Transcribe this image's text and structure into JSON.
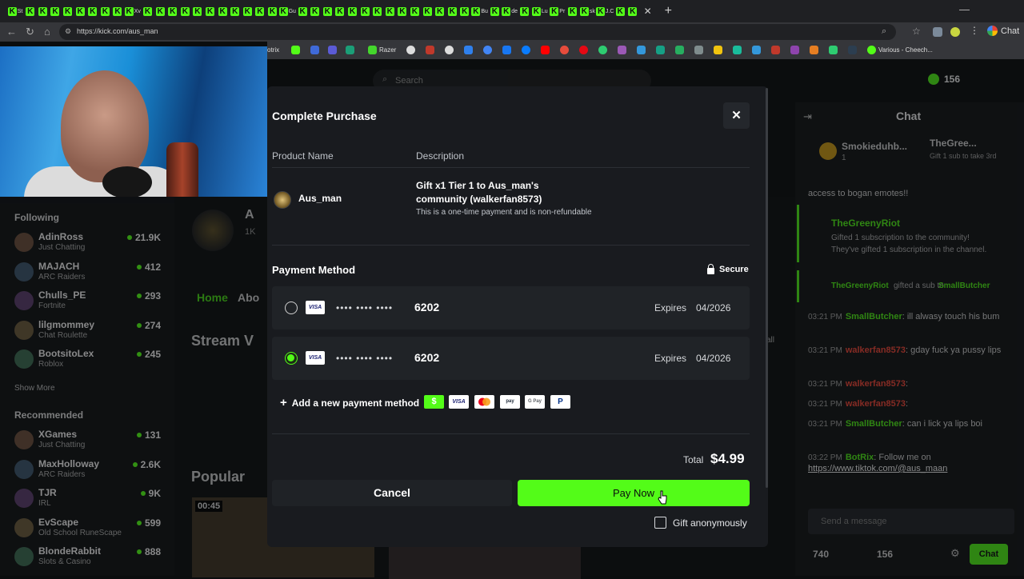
{
  "browser": {
    "url": "https://kick.com/aus_man",
    "chat_tab_label": "Chat",
    "bookmark_labels": {
      "b1": "otrix",
      "b2": "Razer",
      "b3": "Various - Cheech..."
    }
  },
  "tabs_short": [
    "St",
    "",
    "",
    "",
    "",
    "",
    "",
    "",
    "",
    "Xv",
    "",
    "",
    "",
    "",
    "",
    "",
    "",
    "",
    "",
    "",
    "",
    "Gu",
    "",
    "",
    "",
    "",
    "",
    "",
    "",
    "",
    "",
    "",
    "",
    "",
    "",
    "",
    "Bu",
    "",
    "de",
    "",
    "Lu",
    "Pr",
    "",
    "sk",
    "J.C",
    "",
    ""
  ],
  "header": {
    "search_placeholder": "Search",
    "kicks_count": "156"
  },
  "sidebar": {
    "following_label": "Following",
    "show_more": "Show More",
    "recommended_label": "Recommended",
    "following": [
      {
        "name": "AdinRoss",
        "category": "Just Chatting",
        "viewers": "21.9K"
      },
      {
        "name": "MAJACH",
        "category": "ARC Raiders",
        "viewers": "412"
      },
      {
        "name": "Chulls_PE",
        "category": "Fortnite",
        "viewers": "293"
      },
      {
        "name": "lilgmommey",
        "category": "Chat Roulette",
        "viewers": "274"
      },
      {
        "name": "BootsitoLex",
        "category": "Roblox",
        "viewers": "245"
      }
    ],
    "recommended": [
      {
        "name": "XGames",
        "category": "Just Chatting",
        "viewers": "131"
      },
      {
        "name": "MaxHolloway",
        "category": "ARC Raiders",
        "viewers": "2.6K"
      },
      {
        "name": "TJR",
        "category": "IRL",
        "viewers": "9K"
      },
      {
        "name": "EvScape",
        "category": "Old School RuneScape",
        "viewers": "599"
      },
      {
        "name": "BlondeRabbit",
        "category": "Slots & Casino",
        "viewers": "888"
      }
    ]
  },
  "main": {
    "channel_initial": "A",
    "channel_sub": "1K",
    "tab_home": "Home",
    "tab_about": "Abo",
    "stream_heading": "Stream V",
    "popular_heading": "Popular",
    "video_duration": "00:45",
    "all_link": "all"
  },
  "chat": {
    "title": "Chat",
    "pinned_user_left": "Smokieduhb...",
    "pinned_count_left": "1",
    "pinned_user_right": "TheGree...",
    "pinned_note_right": "Gift 1 sub to take 3rd",
    "banner_text": "access to bogan emotes!!",
    "gift_user": "TheGreenyRiot",
    "gift_line1": "Gifted 1 subscription to the community!",
    "gift_line2": "They've gifted 1 subscription in the channel.",
    "gift2_user": "TheGreenyRiot",
    "gift2_text": "gifted a sub to",
    "gift2_target": "SmallButcher",
    "messages": [
      {
        "time": "03:21 PM",
        "user": "SmallButcher",
        "color": "green",
        "text": ": ill alwasy touch his bum"
      },
      {
        "time": "03:21 PM",
        "user": "walkerfan8573",
        "color": "red",
        "text": ": gday fuck ya pussy lips"
      },
      {
        "time": "03:21 PM",
        "user": "walkerfan8573",
        "color": "red",
        "text": ":"
      },
      {
        "time": "03:21 PM",
        "user": "walkerfan8573",
        "color": "red",
        "text": ":"
      },
      {
        "time": "03:21 PM",
        "user": "SmallButcher",
        "color": "green",
        "text": ": can i lick ya lips boi"
      },
      {
        "time": "03:22 PM",
        "user": "BotRix",
        "color": "green",
        "text": ": Follow me on"
      }
    ],
    "link": "https://www.tiktok.com/@aus_maan",
    "input_placeholder": "Send a message",
    "footer_count_left": "740",
    "footer_count_right": "156",
    "send_label": "Chat"
  },
  "modal": {
    "title": "Complete Purchase",
    "col_product": "Product Name",
    "col_description": "Description",
    "product_name": "Aus_man",
    "description_main": "Gift x1 Tier 1 to Aus_man's community (walkerfan8573)",
    "description_sub": "This is a one-time payment and is non-refundable",
    "payment_title": "Payment Method",
    "secure_label": "Secure",
    "cards": [
      {
        "brand": "VISA",
        "masked": "•••• •••• ••••",
        "last4": "6202",
        "expires_label": "Expires",
        "expires": "04/2026",
        "selected": false
      },
      {
        "brand": "VISA",
        "masked": "•••• •••• ••••",
        "last4": "6202",
        "expires_label": "Expires",
        "expires": "04/2026",
        "selected": true
      }
    ],
    "add_method_label": "Add a new payment method",
    "pay_icons": [
      "$",
      "VISA",
      "mastercard",
      "amazon pay",
      "G Pay",
      "P"
    ],
    "total_label": "Total",
    "total_value": "$4.99",
    "cancel_label": "Cancel",
    "pay_label": "Pay Now",
    "gift_anon_label": "Gift anonymously",
    "gift_anon_checked": false
  },
  "colors": {
    "brand_green": "#53fc18",
    "modal_bg": "#191b1f",
    "card_bg": "#202327"
  }
}
